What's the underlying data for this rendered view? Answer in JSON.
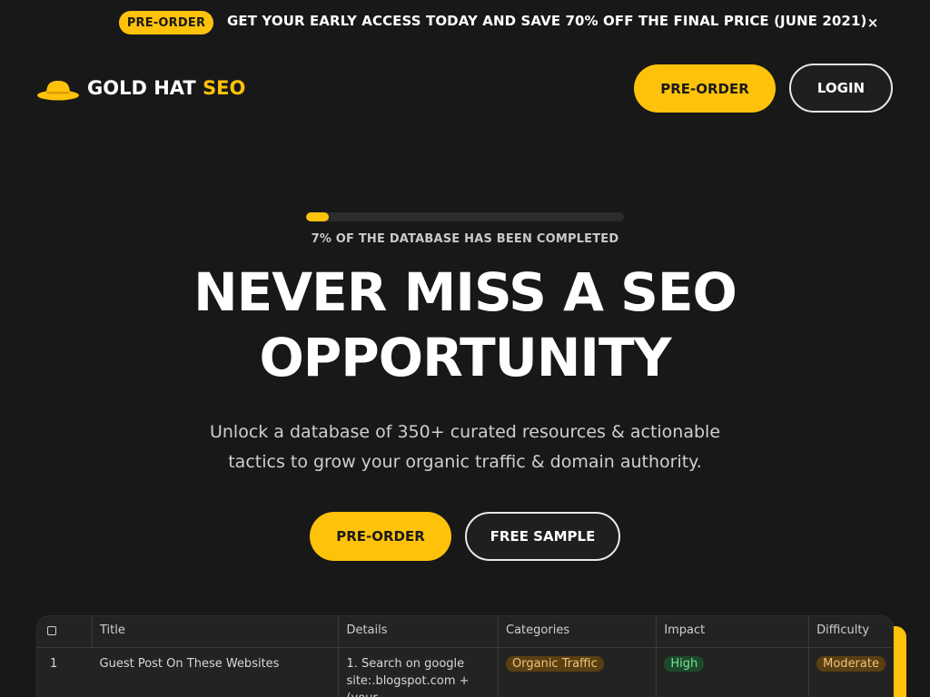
{
  "announcement": {
    "badge": "PRE-ORDER",
    "text": "GET YOUR EARLY ACCESS TODAY AND SAVE 70% OFF THE FINAL PRICE (JUNE 2021)",
    "close": "×"
  },
  "header": {
    "logo_main": "GOLD HAT",
    "logo_accent": "SEO",
    "preorder_label": "PRE-ORDER",
    "login_label": "LOGIN"
  },
  "colors": {
    "accent": "#ffc20a",
    "background": "#181818"
  },
  "progress": {
    "percent": 7,
    "label": "7% OF THE DATABASE HAS BEEN COMPLETED"
  },
  "hero": {
    "title_line1": "NEVER MISS A SEO",
    "title_line2": "OPPORTUNITY",
    "subtitle_line1": "Unlock a database of 350+ curated resources & actionable",
    "subtitle_line2": "tactics to grow your organic traffic & domain authority.",
    "preorder_label": "PRE-ORDER",
    "sample_label": "FREE SAMPLE"
  },
  "table": {
    "columns": [
      "Title",
      "Details",
      "Categories",
      "Impact",
      "Difficulty"
    ],
    "rows": [
      {
        "index": "1",
        "title": "Guest Post On These Websites",
        "details_line1": "1. Search on google",
        "details_line2": "site:.blogspot.com + (your ...",
        "category": "Organic Traffic",
        "impact": "High",
        "difficulty": "Moderate"
      }
    ]
  }
}
